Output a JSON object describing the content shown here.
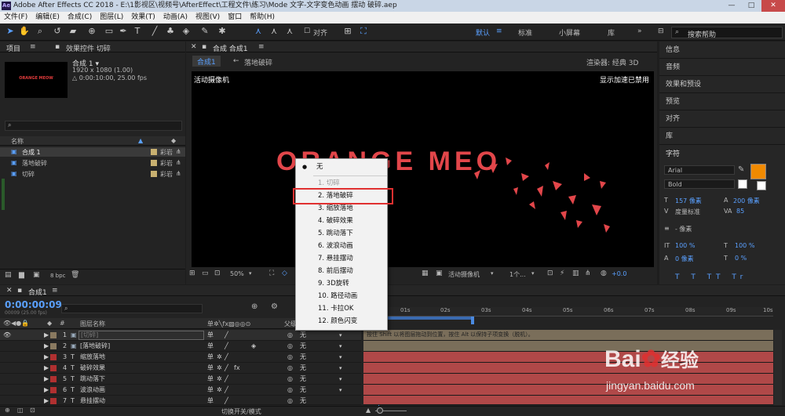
{
  "titlebar": {
    "text": "Adobe After Effects CC 2018 - E:\\1影视区\\视频号\\AfterEffect\\工程文件\\练习\\Mode 文字-文字变色动画 摆动 破碎.aep",
    "min": "—",
    "max": "□",
    "close": "✕"
  },
  "menu": [
    "文件(F)",
    "编辑(E)",
    "合成(C)",
    "图层(L)",
    "效果(T)",
    "动画(A)",
    "视图(V)",
    "窗口",
    "帮助(H)"
  ],
  "toolbar": {
    "align_label": "对齐",
    "workspaces": [
      "默认",
      "标准",
      "小屏幕",
      "库"
    ],
    "search_placeholder": "搜索帮助"
  },
  "project": {
    "tab_project": "项目",
    "tab_effects": "效果控件 切碎",
    "thumb_text": "ORANGE MEOW",
    "comp_name": "合成 1 ▾",
    "comp_dims": "1920 x 1080 (1.00)",
    "comp_dur": "△ 0:00:10:00, 25.00 fps",
    "col_name": "名称",
    "items": [
      {
        "name": "合成 1",
        "type": "彩岩"
      },
      {
        "name": "落地破碎",
        "type": "彩岩"
      },
      {
        "name": "切碎",
        "type": "彩岩"
      }
    ],
    "bpc": "8 bpc"
  },
  "comp": {
    "tab_label": "合成 合成1",
    "subtab_active": "合成1",
    "subtab_other": "落地破碎",
    "renderer": "渲染器: 经典 3D",
    "camera": "活动摄像机",
    "gpu": "显示加速已禁用",
    "canvas_text": "ORANGE MEO",
    "zoom": "50%",
    "camera_select": "活动摄像机",
    "views": "1个...",
    "exposure": "+0.0"
  },
  "dropdown": {
    "selected": "无",
    "items": [
      "1. 切碎",
      "2. 落地破碎",
      "3. 缩放落地",
      "4. 破碎效果",
      "5. 跳动落下",
      "6. 波浪动画",
      "7. 悬挂摆动",
      "8. 前后摆动",
      "9. 3D旋转",
      "10. 路径动画",
      "11. 卡拉OK",
      "12. 颜色闪变"
    ]
  },
  "right_panel": {
    "items": [
      "信息",
      "音频",
      "效果和预设",
      "预览",
      "对齐",
      "库"
    ],
    "char_title": "字符",
    "font": "Arial",
    "style": "Bold",
    "size": "157 像素",
    "leading": "200 像素",
    "kerning": "度量标准",
    "tracking": "85",
    "stroke": "- 像素",
    "vscale": "100 %",
    "hscale": "100 %",
    "baseline": "0 像素",
    "tsume": "0 %",
    "fill_color": "#f08a00"
  },
  "timeline": {
    "tab": "合成1",
    "timecode": "0:00:00:09",
    "frames": "00009 (25.00 fps)",
    "col_layer_name": "图层名称",
    "col_parent": "父级",
    "rows": [
      {
        "num": "1",
        "name": "[切碎]",
        "parent": "无",
        "color": "#8a7a60"
      },
      {
        "num": "2",
        "name": "[落地破碎]",
        "parent": "无",
        "color": "#8a7a60"
      },
      {
        "num": "3",
        "name": "缩放落地",
        "parent": "无",
        "color": "#b03030"
      },
      {
        "num": "4",
        "name": "破碎效果",
        "parent": "无",
        "color": "#b03030"
      },
      {
        "num": "5",
        "name": "跳动落下",
        "parent": "无",
        "color": "#b03030"
      },
      {
        "num": "6",
        "name": "波浪动画",
        "parent": "无",
        "color": "#b03030"
      },
      {
        "num": "7",
        "name": "悬挂摆动",
        "parent": "无",
        "color": "#b03030"
      }
    ],
    "ruler": [
      "0s",
      "01s",
      "02s",
      "03s",
      "04s",
      "05s",
      "06s",
      "07s",
      "08s",
      "09s",
      "10s"
    ],
    "hint": "按住 Shift 以将图层拖动到位置，按住 Alt 以保持子项变换（脱机）。",
    "switch_mode": "切换开关/模式"
  },
  "watermark": {
    "brand": "Bai",
    "brand2": "经验",
    "url": "jingyan.baidu.com"
  }
}
